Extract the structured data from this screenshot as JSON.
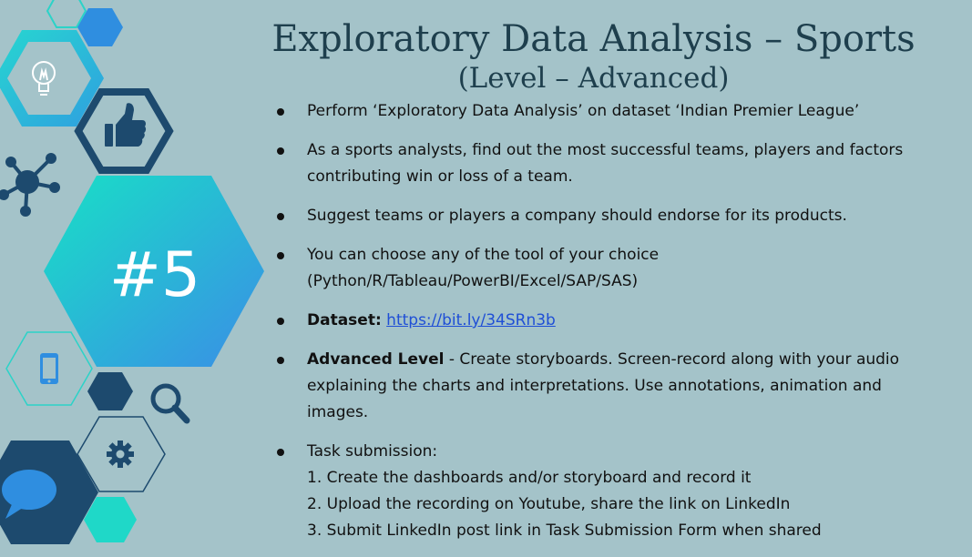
{
  "slide": {
    "title": "Exploratory Data Analysis – Sports",
    "subtitle": "(Level – Advanced)",
    "badge": "#5"
  },
  "bullets": {
    "b1": "Perform ‘Exploratory Data Analysis’ on dataset  ‘Indian Premier League’",
    "b2_line1": "As a sports analysts, find out the most successful teams, players and factors",
    "b2_line2": "contributing win or loss of a team.",
    "b3": "Suggest teams or players a company should endorse for its products.",
    "b4_line1": "You can choose any of the tool of your choice",
    "b4_line2": "(Python/R/Tableau/PowerBI/Excel/SAP/SAS)",
    "b5_label": "Dataset:",
    "b5_link": "https://bit.ly/34SRn3b",
    "b6_label": "Advanced Level",
    "b6_line1": " - Create storyboards. Screen-record along with your audio",
    "b6_line2": "explaining the charts and interpretations. Use annotations, animation and",
    "b6_line3": "images.",
    "b7_title": "Task submission:",
    "b7_step1": "1. Create the dashboards and/or storyboard and record it",
    "b7_step2": "2. Upload the recording on Youtube, share the link on LinkedIn",
    "b7_step3": "3. Submit LinkedIn post link in Task Submission Form when shared"
  },
  "colors": {
    "background": "#a4c3c9",
    "navy": "#1d4a6e",
    "cyan": "#1fd8c8",
    "blue": "#2f8ee0",
    "link": "#1f4fd6"
  },
  "icons": [
    "lightbulb-icon",
    "thumbs-up-icon",
    "network-icon",
    "phone-icon",
    "magnifier-icon",
    "gear-icon",
    "chat-bubble-icon"
  ]
}
